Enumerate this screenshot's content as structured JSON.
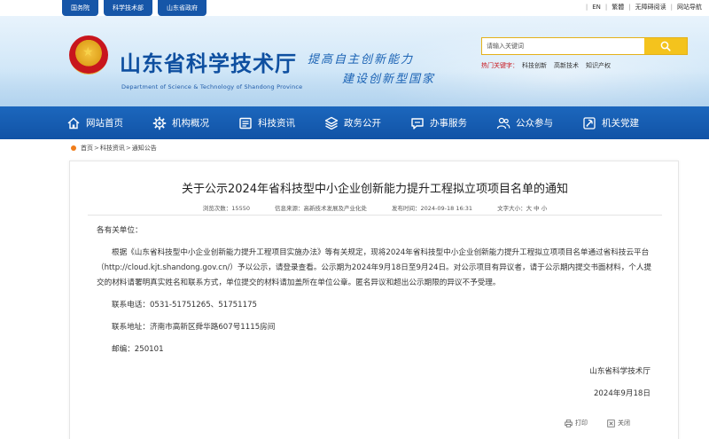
{
  "top_links": [
    "国务院",
    "科学技术部",
    "山东省政府"
  ],
  "top_right": [
    "EN",
    "繁體",
    "无障碍阅读",
    "网站导航"
  ],
  "header": {
    "site_title": "山东省科学技术厅",
    "site_subtitle": "Department of Science & Technology of Shandong Province",
    "slogan_line1": "提高自主创新能力",
    "slogan_line2": "建设创新型国家"
  },
  "search": {
    "placeholder": "请输入关键词",
    "hot_label": "热门关键字：",
    "hot_words": [
      "科技创新",
      "高新技术",
      "知识产权"
    ]
  },
  "nav": [
    {
      "label": "网站首页",
      "icon": "home-icon"
    },
    {
      "label": "机构概况",
      "icon": "gear-icon"
    },
    {
      "label": "科技资讯",
      "icon": "news-icon"
    },
    {
      "label": "政务公开",
      "icon": "layers-icon"
    },
    {
      "label": "办事服务",
      "icon": "chat-icon"
    },
    {
      "label": "公众参与",
      "icon": "users-icon"
    },
    {
      "label": "机关党建",
      "icon": "party-icon"
    }
  ],
  "breadcrumb": {
    "home": "首页",
    "section": "科技资讯",
    "current": "通知公告",
    "separator": ">"
  },
  "article": {
    "title": "关于公示2024年省科技型中小企业创新能力提升工程拟立项项目名单的通知",
    "views_label": "浏览次数：",
    "views": "15550",
    "source_label": "信息来源：",
    "source": "高新技术发展及产业化处",
    "date_label": "发布时间：",
    "date": "2024-09-18 16:31",
    "fontsize_label": "文字大小：",
    "fontsize_options": "大 中 小",
    "greeting": "各有关单位：",
    "paragraph": "根据《山东省科技型中小企业创新能力提升工程项目实施办法》等有关规定，现将2024年省科技型中小企业创新能力提升工程拟立项项目名单通过省科技云平台（http://cloud.kjt.shandong.gov.cn/）予以公示，请登录查看。公示期为2024年9月18日至9月24日。对公示项目有异议者，请于公示期内提交书面材料，个人提交的材料请署明真实姓名和联系方式，单位提交的材料请加盖所在单位公章。匿名异议和超出公示期限的异议不予受理。",
    "phone": "联系电话：0531-51751265、51751175",
    "address": "联系地址：济南市高新区舜华路607号1115房间",
    "postcode": "邮编：250101",
    "signer": "山东省科学技术厅",
    "sign_date": "2024年9月18日",
    "print_label": "打印",
    "close_label": "关闭"
  },
  "colors": {
    "nav_blue": "#1656a8",
    "accent_yellow": "#f4c31d",
    "hot_red": "#c8161d",
    "crumb_orange": "#f07d1a"
  }
}
